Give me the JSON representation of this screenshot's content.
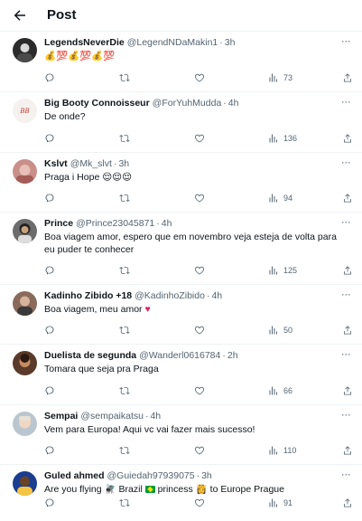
{
  "header": {
    "title": "Post"
  },
  "tweets": [
    {
      "name": "LegendsNeverDie",
      "handle": "@LegendNDaMakin1",
      "time": "3h",
      "text": "💰💯💰💯💰💯",
      "views": "73",
      "avatar_bg": "#2b2b2b",
      "height": 67
    },
    {
      "name": "Big Booty Connoisseur",
      "handle": "@ForYuhMudda",
      "time": "4h",
      "text": "De onde?",
      "views": "136",
      "avatar_bg": "#f4f1ef",
      "height": 67
    },
    {
      "name": "Kslvt",
      "handle": "@Mk_slvt",
      "time": "3h",
      "text": "Praga i Hope 😌😌😌",
      "views": "94",
      "avatar_bg": "#c98f8a",
      "height": 66
    },
    {
      "name": "Prince",
      "handle": "@Prince23045871",
      "time": "4h",
      "text": "Boa viagem amor, espero que em novembro veja esteja de volta para eu puder te conhecer",
      "views": "125",
      "avatar_bg": "#6c6c6c",
      "height": 80
    },
    {
      "name": "Kadinho Zibido +18",
      "handle": "@KadinhoZibido",
      "time": "4h",
      "text": "Boa viagem, meu amor",
      "views": "50",
      "avatar_bg": "#8a6a5a",
      "height": 66
    },
    {
      "name": "Duelista de segunda",
      "handle": "@Wanderl0616784",
      "time": "2h",
      "text": "Tomara que seja pra Praga",
      "views": "66",
      "avatar_bg": "#5a3a2a",
      "height": 67
    },
    {
      "name": "Sempai",
      "handle": "@sempaikatsu",
      "time": "4h",
      "text": "Vem para Europa! Aqui vc vai fazer mais sucesso!",
      "views": "110",
      "avatar_bg": "#b9c6cf",
      "height": 66
    },
    {
      "name": "Guled ahmed",
      "handle": "@Guiedah97939075",
      "time": "3h",
      "text_parts": [
        "Are you flying ",
        " Brazil ",
        " princess ",
        " to Europe Prague"
      ],
      "views": "91",
      "avatar_bg": "#1a3d8f",
      "height": 58
    }
  ],
  "colors": {
    "text": "#0f1419",
    "muted": "#536471",
    "border": "#eff3f4",
    "heart": "#e0245e"
  },
  "icons": {
    "reply": "reply-icon",
    "retweet": "retweet-icon",
    "like": "like-icon",
    "views": "views-icon",
    "share": "share-icon",
    "more": "more-icon",
    "back": "back-arrow-icon"
  }
}
